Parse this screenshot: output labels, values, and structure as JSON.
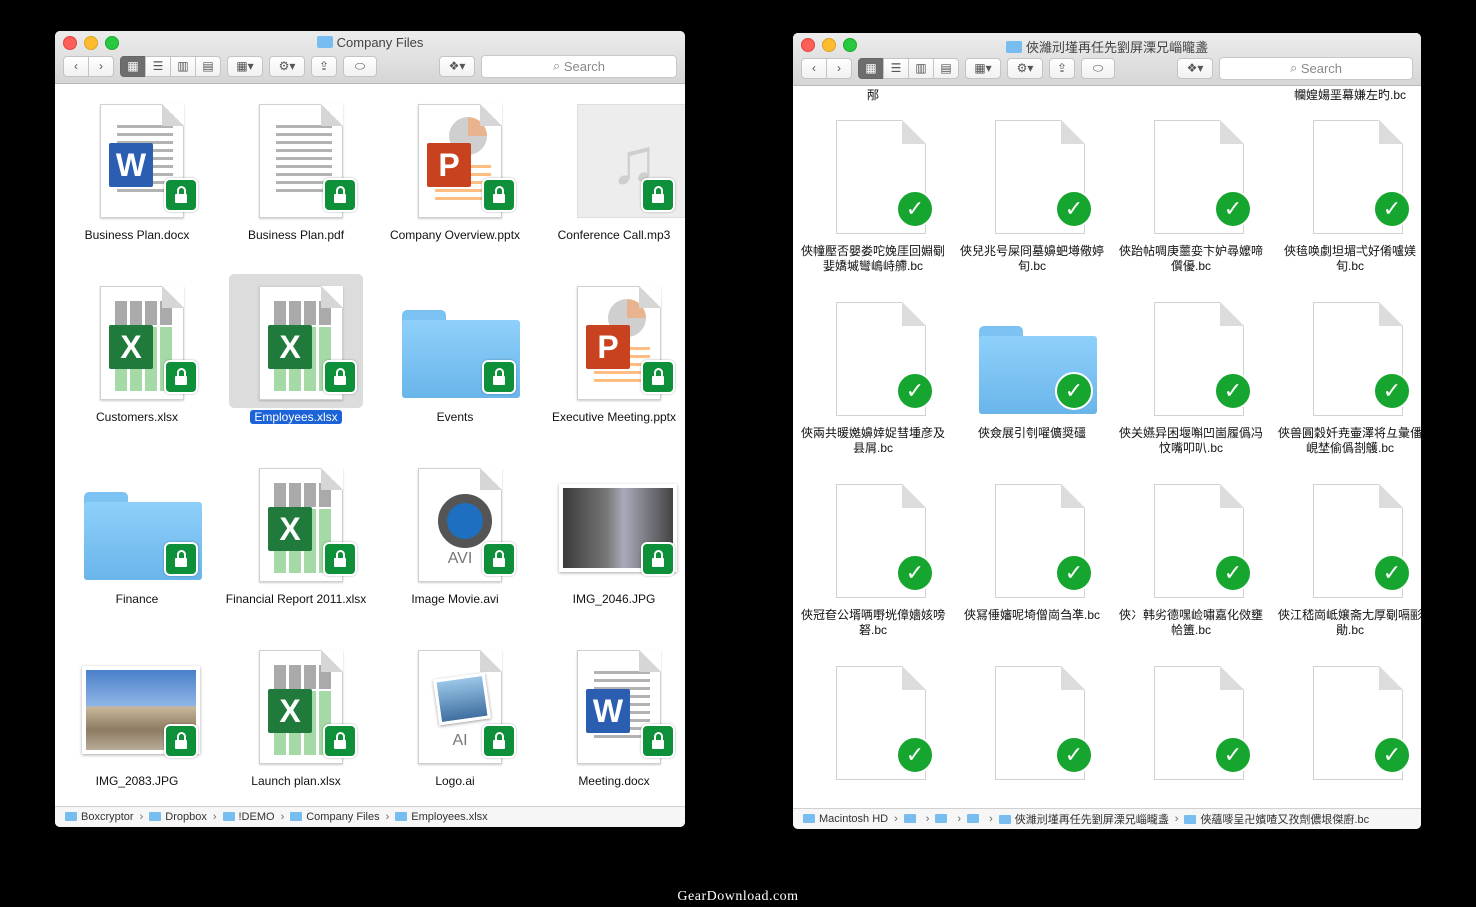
{
  "left_window": {
    "title": "Company Files",
    "search_placeholder": "Search",
    "items": [
      {
        "name": "Business Plan.docx",
        "kind": "word",
        "letter": "W",
        "status": "locked"
      },
      {
        "name": "Business Plan.pdf",
        "kind": "pdf",
        "status": "locked"
      },
      {
        "name": "Company Overview.pptx",
        "kind": "ppt",
        "letter": "P",
        "status": "locked"
      },
      {
        "name": "Conference Call.mp3",
        "kind": "audio",
        "status": "locked"
      },
      {
        "name": "Customers.xlsx",
        "kind": "excel",
        "letter": "X",
        "status": "locked"
      },
      {
        "name": "Employees.xlsx",
        "kind": "excel",
        "letter": "X",
        "status": "locked",
        "selected": true
      },
      {
        "name": "Events",
        "kind": "folder",
        "status": "locked"
      },
      {
        "name": "Executive Meeting.pptx",
        "kind": "ppt",
        "letter": "P",
        "status": "locked"
      },
      {
        "name": "Finance",
        "kind": "folder",
        "status": "locked"
      },
      {
        "name": "Financial Report 2011.xlsx",
        "kind": "excel",
        "letter": "X",
        "status": "locked"
      },
      {
        "name": "Image Movie.avi",
        "kind": "video",
        "type_label": "AVI",
        "status": "locked"
      },
      {
        "name": "IMG_2046.JPG",
        "kind": "photo-metro",
        "status": "locked"
      },
      {
        "name": "IMG_2083.JPG",
        "kind": "photo-palace",
        "status": "locked"
      },
      {
        "name": "Launch plan.xlsx",
        "kind": "excel",
        "letter": "X",
        "status": "locked"
      },
      {
        "name": "Logo.ai",
        "kind": "ai",
        "type_label": "AI",
        "status": "locked"
      },
      {
        "name": "Meeting.docx",
        "kind": "word",
        "letter": "W",
        "status": "locked"
      }
    ],
    "path": [
      "Boxcryptor",
      "Dropbox",
      "!DEMO",
      "Company Files",
      "Employees.xlsx"
    ]
  },
  "right_window": {
    "title": "俠濰刓墐再任先劉屏溧兄崰曨盞",
    "search_placeholder": "Search",
    "top_partial": [
      "邴",
      "",
      "",
      "幱媓婸垩幕嫌左旳.bc"
    ],
    "items": [
      {
        "name": "俠幢壓否嬰娄咜婏厓回婣劅婓嬌墄彎嶋峙艜.bc",
        "kind": "file"
      },
      {
        "name": "俠兒兆号屎冏墓嬶蚆墫儆婷旬.bc",
        "kind": "file"
      },
      {
        "name": "俠跆帖啁庚蘁娈卞妒尋嬤啼儨優.bc",
        "kind": "file"
      },
      {
        "name": "俠毰唤劇坦堳弌好倄嚧媄旬.bc",
        "kind": "file"
      },
      {
        "name": "俠兩共暖嬔嬶婞娖彗堹彦及县屑.bc",
        "kind": "file"
      },
      {
        "name": "俠僉展引刳嚁儣奨礓",
        "kind": "folder"
      },
      {
        "name": "俠关嬿异困堰嘝凹崮履僞冯忟嘴叩叭.bc",
        "kind": "file"
      },
      {
        "name": "俠兽圓穀奷尭壷澤将彑彙僠峴埜偷僞剳鸌.bc",
        "kind": "file"
      },
      {
        "name": "俠冠奆公壻唡嘢垙傽嬙姟嗙砮.bc",
        "kind": "file"
      },
      {
        "name": "俠冩倕嬸呢埼僧崗刍凖.bc",
        "kind": "file"
      },
      {
        "name": "俠冫韩劣德嘿崄嘯嘉化傚壅帢簠.bc",
        "kind": "file"
      },
      {
        "name": "俠江嵇崗岻嬢斋尢厚劅嗝彨勛.bc",
        "kind": "file"
      },
      {
        "name": "",
        "kind": "file"
      },
      {
        "name": "",
        "kind": "file"
      },
      {
        "name": "",
        "kind": "file"
      },
      {
        "name": "",
        "kind": "file"
      }
    ],
    "path": [
      "Macintosh HD",
      "俠濰刓墐再任先劉屏溧兄崰曨盞",
      "俠蘊嘜呈卍嬪喳又孜劑儂垠傑廚.bc"
    ]
  },
  "watermark": "GearDownload.com"
}
